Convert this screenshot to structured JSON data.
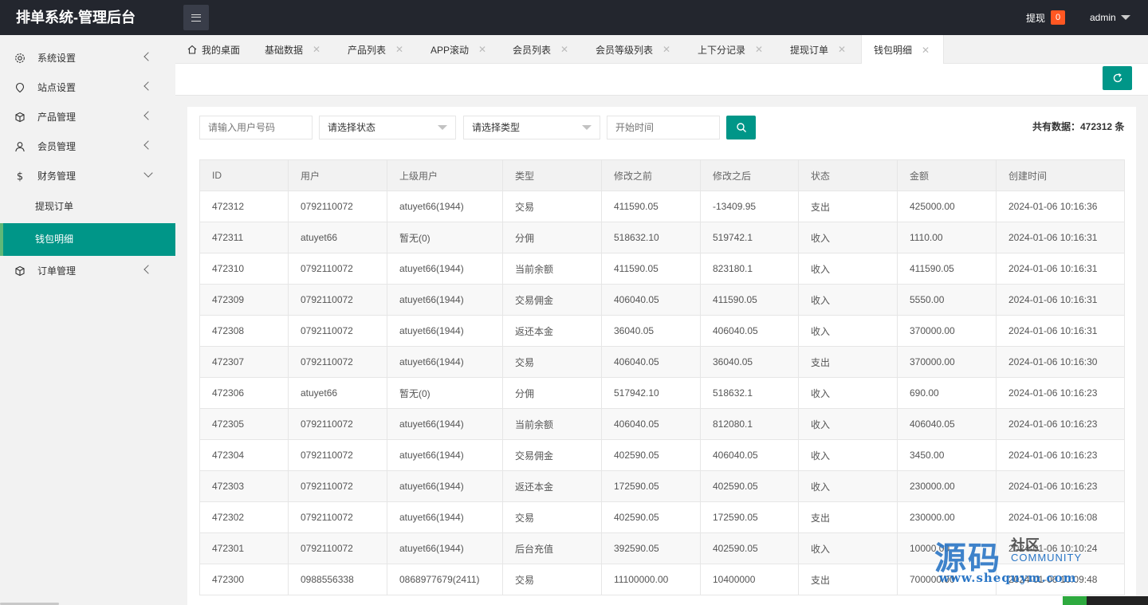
{
  "header": {
    "brand": "排单系统-管理后台",
    "withdraw_label": "提现",
    "withdraw_count": "0",
    "user": "admin"
  },
  "sidebar": {
    "items": [
      {
        "label": "系统设置",
        "icon": "gear-icon"
      },
      {
        "label": "站点设置",
        "icon": "location-icon"
      },
      {
        "label": "产品管理",
        "icon": "cube-icon"
      },
      {
        "label": "会员管理",
        "icon": "user-icon"
      },
      {
        "label": "财务管理",
        "icon": "dollar-icon"
      },
      {
        "label": "订单管理",
        "icon": "cube-icon"
      }
    ],
    "finance_sub": [
      {
        "label": "提现订单"
      },
      {
        "label": "钱包明细"
      }
    ]
  },
  "tabs": [
    {
      "label": "我的桌面"
    },
    {
      "label": "基础数据"
    },
    {
      "label": "产品列表"
    },
    {
      "label": "APP滚动"
    },
    {
      "label": "会员列表"
    },
    {
      "label": "会员等级列表"
    },
    {
      "label": "上下分记录"
    },
    {
      "label": "提现订单"
    },
    {
      "label": "钱包明细"
    }
  ],
  "filters": {
    "user_placeholder": "请输入用户号码",
    "status_select": "请选择状态",
    "type_select": "请选择类型",
    "start_time_placeholder": "开始时间"
  },
  "total_label": "共有数据：472312 条",
  "table": {
    "headers": [
      "ID",
      "用户",
      "上级用户",
      "类型",
      "修改之前",
      "修改之后",
      "状态",
      "金额",
      "创建时间"
    ],
    "rows": [
      [
        "472312",
        "0792110072",
        "atuyet66(1944)",
        "交易",
        "411590.05",
        "-13409.95",
        "支出",
        "425000.00",
        "2024-01-06 10:16:36"
      ],
      [
        "472311",
        "atuyet66",
        "暂无(0)",
        "分佣",
        "518632.10",
        "519742.1",
        "收入",
        "1110.00",
        "2024-01-06 10:16:31"
      ],
      [
        "472310",
        "0792110072",
        "atuyet66(1944)",
        "当前余额",
        "411590.05",
        "823180.1",
        "收入",
        "411590.05",
        "2024-01-06 10:16:31"
      ],
      [
        "472309",
        "0792110072",
        "atuyet66(1944)",
        "交易佣金",
        "406040.05",
        "411590.05",
        "收入",
        "5550.00",
        "2024-01-06 10:16:31"
      ],
      [
        "472308",
        "0792110072",
        "atuyet66(1944)",
        "返还本金",
        "36040.05",
        "406040.05",
        "收入",
        "370000.00",
        "2024-01-06 10:16:31"
      ],
      [
        "472307",
        "0792110072",
        "atuyet66(1944)",
        "交易",
        "406040.05",
        "36040.05",
        "支出",
        "370000.00",
        "2024-01-06 10:16:30"
      ],
      [
        "472306",
        "atuyet66",
        "暂无(0)",
        "分佣",
        "517942.10",
        "518632.1",
        "收入",
        "690.00",
        "2024-01-06 10:16:23"
      ],
      [
        "472305",
        "0792110072",
        "atuyet66(1944)",
        "当前余额",
        "406040.05",
        "812080.1",
        "收入",
        "406040.05",
        "2024-01-06 10:16:23"
      ],
      [
        "472304",
        "0792110072",
        "atuyet66(1944)",
        "交易佣金",
        "402590.05",
        "406040.05",
        "收入",
        "3450.00",
        "2024-01-06 10:16:23"
      ],
      [
        "472303",
        "0792110072",
        "atuyet66(1944)",
        "返还本金",
        "172590.05",
        "402590.05",
        "收入",
        "230000.00",
        "2024-01-06 10:16:23"
      ],
      [
        "472302",
        "0792110072",
        "atuyet66(1944)",
        "交易",
        "402590.05",
        "172590.05",
        "支出",
        "230000.00",
        "2024-01-06 10:16:08"
      ],
      [
        "472301",
        "0792110072",
        "atuyet66(1944)",
        "后台充值",
        "392590.05",
        "402590.05",
        "收入",
        "10000.00",
        "2024-01-06 10:10:24"
      ],
      [
        "472300",
        "0988556338",
        "0868977679(2411)",
        "交易",
        "11100000.00",
        "10400000",
        "支出",
        "700000.00",
        "2024-01-06 10:09:48"
      ]
    ]
  },
  "watermark": {
    "big": "源码",
    "she": "社区",
    "community": "COMMUNITY",
    "url": "www.shequym.com"
  }
}
